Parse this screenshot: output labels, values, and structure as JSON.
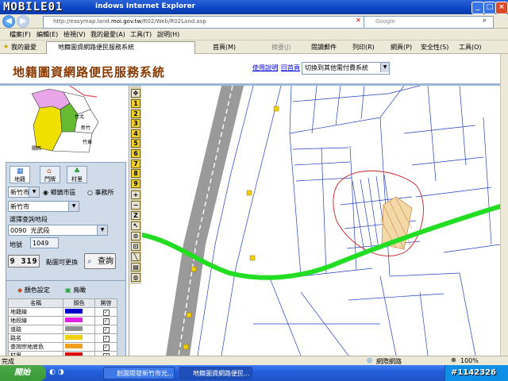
{
  "window": {
    "site_logo": "MOBILE01",
    "title": "indows Internet Explorer",
    "minimize": "_",
    "maximize": "□",
    "close": "×"
  },
  "address_bar": {
    "url_prefix": "http://easymap.land.",
    "url_host": "moi.gov.tw",
    "url_suffix": "/R02/Web/R02Land.asp",
    "search_placeholder": "Google"
  },
  "menu": [
    "檔案(F)",
    "編輯(E)",
    "檢視(V)",
    "我的最愛(A)",
    "工具(T)",
    "說明(H)"
  ],
  "favorites_bar": {
    "favorites_label": "我的最愛",
    "tab_label": "地籍圖資網路便民服務系統",
    "home": "首頁(M)",
    "feeds": "摘要(J)",
    "mail": "閱讀郵件",
    "print": "列印(R)",
    "page": "網頁(P)",
    "safety": "安全性(S)",
    "tools": "工具(O)"
  },
  "page_header": {
    "title": "地籍圖資網路便民服務系統",
    "help_link": "使用說明",
    "home_link": "回首頁",
    "separator": "|",
    "select_value": "切換到其他需付費系統"
  },
  "minimap": {
    "labels": [
      "竹北",
      "新竹",
      "竹東",
      "關西"
    ]
  },
  "query": {
    "tabs": [
      "地籍",
      "門牌",
      "村里"
    ],
    "county": "新竹市",
    "radio_option_1": "鄉鎮市區",
    "radio_option_2": "事務所",
    "district": "新竹市",
    "section_label": "選擇查詢地段",
    "section_code": "0090",
    "section_name": "光武段",
    "lot_label": "地號",
    "lot_number": "1049",
    "captcha_code": "9 319",
    "captcha_refresh": "點圖可更換",
    "query_button": "查詢"
  },
  "color_settings": {
    "tab_color": "顏色設定",
    "tab_map": "鳥瞰",
    "headers": [
      "名稱",
      "顏色",
      "開啓"
    ],
    "rows": [
      {
        "name": "地籍線",
        "color": "#0000cc",
        "checked": "✓"
      },
      {
        "name": "地段線",
        "color": "#e020e0",
        "checked": "✓"
      },
      {
        "name": "道路",
        "color": "#909090",
        "checked": "✓"
      },
      {
        "name": "路名",
        "color": "#f0d000",
        "checked": "✓"
      },
      {
        "name": "查詢宗地底色",
        "color": "#f0a020",
        "checked": "✓"
      },
      {
        "name": "村里",
        "color": "#e00000",
        "checked": "✓"
      }
    ]
  },
  "map_tools": {
    "numbers": [
      "1",
      "2",
      "3",
      "4",
      "5",
      "6",
      "7",
      "8",
      "9"
    ]
  },
  "status_bar": {
    "left_text": "完成",
    "zone": "網際網路",
    "zoom": "100%"
  },
  "taskbar": {
    "start_label": "開始",
    "tasks": [
      "創園閱發新竹市光...",
      "地籍圖資網路便民..."
    ],
    "watermark": "#1142326"
  },
  "colors": {
    "title_brown": "#8a3a00",
    "parcel_line": "#2040c0",
    "road_gray": "#9a9a9a",
    "green_line": "#22dd22",
    "highlight_red": "#cc2020"
  }
}
